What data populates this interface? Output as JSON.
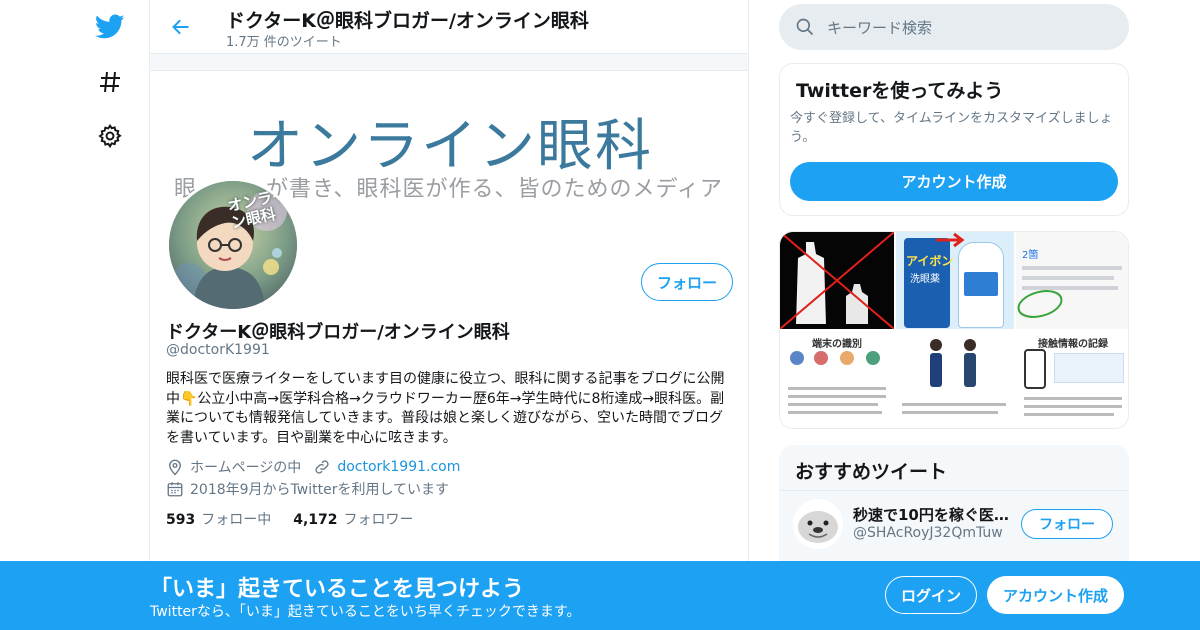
{
  "colors": {
    "accent": "#1da1f2",
    "text": "#14171a",
    "muted": "#657786",
    "banner_text": "#3c7a9d"
  },
  "nav": {
    "icons": [
      "twitter-bird-icon",
      "hashtag-icon",
      "gear-icon"
    ]
  },
  "header": {
    "title": "ドクターK＠眼科ブロガー/オンライン眼科",
    "tweet_count": "1.7万 件のツイート"
  },
  "banner": {
    "title": "オンライン眼科",
    "subtitle": "眼　　　が書き、眼科医が作る、皆のためのメディア"
  },
  "avatar": {
    "overlay_text": "オンライン眼科"
  },
  "profile": {
    "follow_label": "フォロー",
    "name": "ドクターK＠眼科ブロガー/オンライン眼科",
    "handle": "@doctorK1991",
    "bio": "眼科医で医療ライターをしています目の健康に役立つ、眼科に関する記事をブログに公開中👇公立小中高→医学科合格→クラウドワーカー歴6年→学生時代に8桁達成→眼科医。副業についても情報発信していきます。普段は娘と楽しく遊びながら、空いた時間でブログを書いています。目や副業を中心に呟きます。",
    "location": "ホームページの中",
    "url": "doctork1991.com",
    "joined": "2018年9月からTwitterを利用しています",
    "following_count": "593",
    "following_label": "フォロー中",
    "followers_count": "4,172",
    "followers_label": "フォロワー"
  },
  "search": {
    "placeholder": "キーワード検索"
  },
  "signup_card": {
    "title": "Twitterを使ってみよう",
    "text": "今すぐ登録して、タイムラインをカスタマイズしましょう。",
    "button": "アカウント作成"
  },
  "media": {
    "labels": {
      "eyedrop_brand": "アイボン",
      "eyedrop_sub": "洗眼薬",
      "screenshot_header": "2箇",
      "terminal_title": "端末の識別",
      "contact_title": "接触情報の記録"
    }
  },
  "recommended": {
    "title": "おすすめツイート",
    "account_name": "秒速で10円を稼ぐ医…",
    "account_handle": "@SHAcRoyJ32QmTuw",
    "follow_label": "フォロー"
  },
  "bottom_bar": {
    "title": "「いま」起きていることを見つけよう",
    "subtitle": "Twitterなら、「いま」起きていることをいち早くチェックできます。",
    "login": "ログイン",
    "signup": "アカウント作成"
  }
}
